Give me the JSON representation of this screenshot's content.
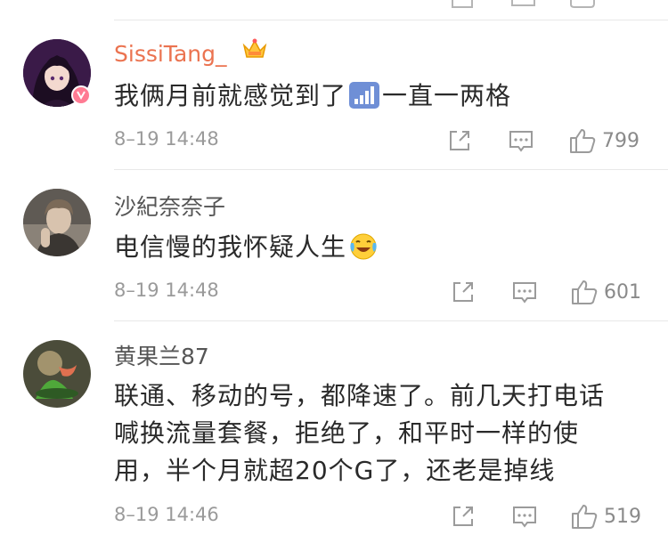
{
  "comments": [
    {
      "username": "SissiTang_",
      "text_before_icon": "我俩月前就感觉到了",
      "inline_icon": "signal-bars-icon",
      "text_after_icon": "一直一两格",
      "timestamp": "8–19 14:48",
      "like_count": "799",
      "is_vip": true
    },
    {
      "username": "沙紀奈奈子",
      "text_before_icon": "电信慢的我怀疑人生",
      "inline_icon": "laughing-crying-emoji-icon",
      "text_after_icon": "",
      "timestamp": "8–19 14:48",
      "like_count": "601",
      "is_vip": false
    },
    {
      "username": "黄果兰87",
      "text_lines": [
        "联通、移动的号，都降速了。前几天打电话",
        "喊换流量套餐，拒绝了，和平时一样的使",
        "用，半个月就超20个G了，还老是掉线"
      ],
      "timestamp": "8–19 14:46",
      "like_count": "519",
      "is_vip": false
    }
  ],
  "icons": {
    "repost": "repost-icon",
    "comment": "comment-icon",
    "like": "thumbs-up-icon",
    "crown": "crown-icon",
    "vip_badge": "vip-badge-icon"
  },
  "colors": {
    "vip_username": "#eb7350",
    "normal_username": "#555555",
    "meta_gray": "#9a9a9a",
    "action_gray": "#9b9b9b"
  }
}
